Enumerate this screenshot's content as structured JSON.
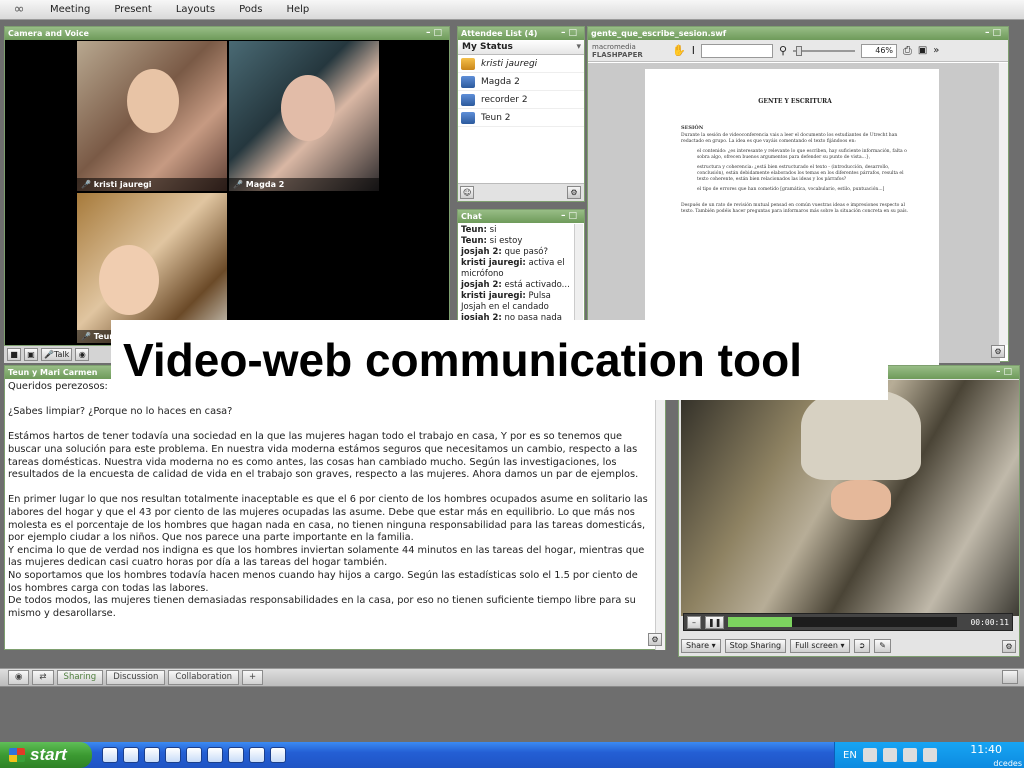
{
  "menu": [
    "Meeting",
    "Present",
    "Layouts",
    "Pods",
    "Help"
  ],
  "camera": {
    "title": "Camera and Voice",
    "videos": [
      {
        "name": "kristi jauregi"
      },
      {
        "name": "Magda 2"
      },
      {
        "name": "Teun 2"
      }
    ],
    "talk_label": "Talk"
  },
  "attendees": {
    "title": "Attendee List (4)",
    "my_status": "My Status",
    "list": [
      {
        "name": "kristi jauregi",
        "role": "host"
      },
      {
        "name": "Magda 2",
        "role": "participant"
      },
      {
        "name": "recorder 2",
        "role": "participant"
      },
      {
        "name": "Teun 2",
        "role": "participant"
      }
    ]
  },
  "chat": {
    "title": "Chat",
    "messages": [
      {
        "who": "Teun:",
        "text": " si"
      },
      {
        "who": "Teun:",
        "text": " si estoy"
      },
      {
        "who": "josjah 2:",
        "text": " que pasó?"
      },
      {
        "who": "kristi jauregi:",
        "text": " activa el micrófono"
      },
      {
        "who": "josjah 2:",
        "text": " está activado..."
      },
      {
        "who": "kristi jauregi:",
        "text": " Pulsa Josjah en el candado"
      },
      {
        "who": "josjah 2:",
        "text": " no pasa nada"
      }
    ]
  },
  "document": {
    "title": "gente_que_escribe_sesion.swf",
    "logo_line1": "macromedia",
    "logo_line2": "FLASHPAPER",
    "zoom": "46%",
    "page_title": "GENTE Y ESCRITURA",
    "section": "SESIÓN",
    "para1": "Durante la sesión de videoconferencia vais a leer el documento los estudiantes de Utrecht han redactado en grupo. La idea es que vayáis comentando el texto fijándoos en:",
    "bullets": [
      "el contenido: ¿es interesante y relevante lo que escriben, hay suficiente información, falta o sobra algo, ofrecen buenos argumentos para defender su punto de vista...},",
      "estructura y coherencia: ¿está bien estructurado el texto - (introducción, desarrollo, conclusión), están debidamente elaborados los temas en los diferentes párrafos, resulta el texto coherente, están bien relacionados las ideas y los párrafos?",
      "el tipo de errores que han cometido [gramática, vocabulario, estilo, puntuación...]"
    ],
    "para2": "Después de un rato de revisión mutual pensad en común vuestras ideas e impresiones respecto al texto. También podéis hacer preguntas para informaros más sobre la situación concreta en su país."
  },
  "notes": {
    "title": "Teun y Mari Carmen",
    "paragraphs": [
      [
        "Queridos perezosos:"
      ],
      [
        "¿Sabes limpiar? ¿Porque no lo haces en casa?"
      ],
      [
        "Estámos hartos de tener todavía una sociedad en la que las mujeres hagan todo el trabajo en casa, Y por es so tenemos que buscar una solución para este problema. En nuestra vida moderna estámos seguros que necesitamos un cambio, respecto a las tareas domésticas. Nuestra vida moderna no es como antes, las cosas han cambiado mucho. Según las investigaciones, los resultados de la encuesta de calidad de vida en el trabajo son graves, respecto a las mujeres. Ahora damos un par de ejemplos."
      ],
      [
        "En primer lugar lo que nos resultan totalmente inaceptable es que el 6 por ciento de los hombres ocupados asume en solitario las labores del hogar y que el 43 por ciento de las mujeres ocupadas las asume. Debe que estar más en equilibrio. Lo que más nos molesta es el porcentaje de los hombres que hagan nada en casa, no tienen ninguna responsabilidad para las tareas domesticás, por ejemplo ciudar a los niños. Que nos parece una parte importante en la familia.",
        "Y encima lo que de verdad nos indigna es que los hombres inviertan solamente 44 minutos en las tareas del hogar, mientras que las mujeres dedican casi cuatro horas por día a las tareas del hogar también.",
        "No soportamos que los hombres todavía hacen menos cuando hay hijos a cargo. Según las estadísticas solo el 1.5 por ciento de los hombres carga con todas las labores.",
        "De todos modos, las mujeres tienen demasiadas responsabilidades en la casa, por eso no tienen suficiente tiempo libre para su mismo y desarollarse."
      ]
    ]
  },
  "share": {
    "time": "00:00:11",
    "progress": 0.28,
    "buttons": [
      "Share",
      "Stop Sharing",
      "Full screen"
    ]
  },
  "layouts": {
    "tabs": [
      "Sharing",
      "Discussion",
      "Collaboration"
    ],
    "active": "Sharing",
    "add": "+"
  },
  "overlay": {
    "title": "Video-web communication tool"
  },
  "taskbar": {
    "start": "start",
    "lang": "EN",
    "clock": "11:40",
    "user": "dcedes"
  },
  "colors": {
    "pod_header": "#6e9a5a",
    "taskbar": "#245fd4",
    "start": "#3c9a32"
  }
}
